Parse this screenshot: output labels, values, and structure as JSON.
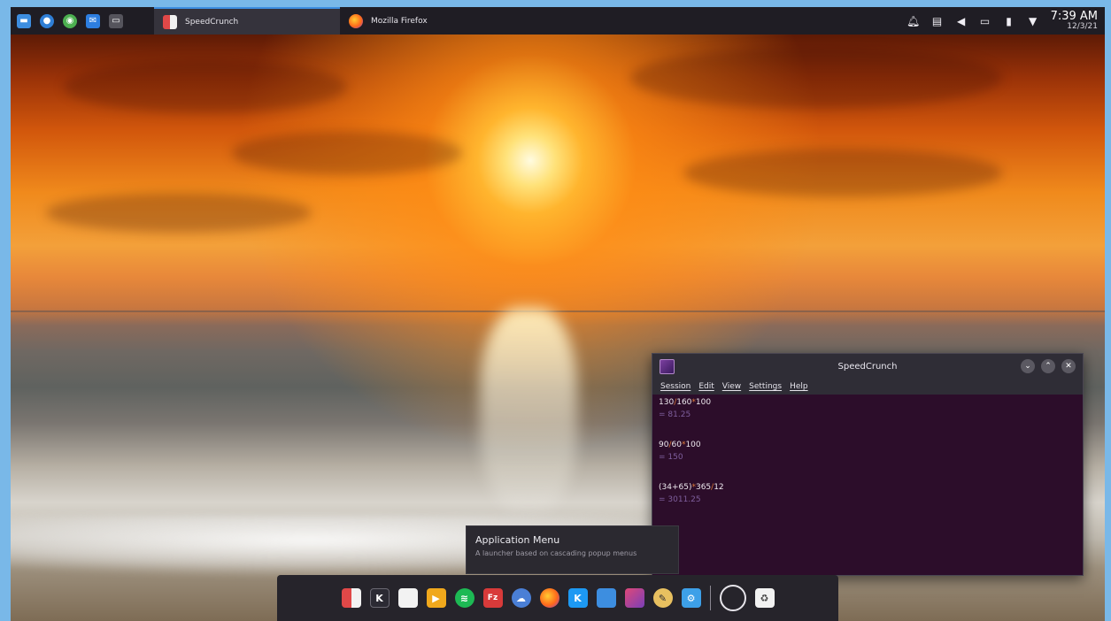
{
  "top_panel": {
    "launchers": [
      {
        "name": "dolphin-icon",
        "color": "#3d8ee0"
      },
      {
        "name": "discover-icon",
        "color": "#2f7fd6"
      },
      {
        "name": "chrome-icon",
        "color": "#4caf50"
      },
      {
        "name": "kmail-icon",
        "color": "#2d7ee0"
      },
      {
        "name": "terminal-icon",
        "color": "#55545c"
      }
    ],
    "tasks": [
      {
        "label": "SpeedCrunch",
        "icon": "speedcrunch-icon",
        "active": true
      },
      {
        "label": "Mozilla Firefox",
        "icon": "firefox-icon",
        "active": false
      }
    ],
    "tray": [
      "bell-icon",
      "clipboard-icon",
      "volume-icon",
      "battery-icon",
      "usb-icon",
      "wifi-icon"
    ],
    "clock": {
      "time": "7:39 AM",
      "date": "12/3/21"
    }
  },
  "speedcrunch": {
    "title": "SpeedCrunch",
    "menu": [
      "Session",
      "Edit",
      "View",
      "Settings",
      "Help"
    ],
    "entries": [
      {
        "expr_parts": [
          "130",
          "/",
          "160",
          "*",
          "100"
        ],
        "result": "= 81.25"
      },
      {
        "expr_parts": [
          "90",
          "/",
          "60",
          "*",
          "100"
        ],
        "result": "= 150"
      },
      {
        "expr_parts": [
          "(34+65)",
          "*",
          "365",
          "/",
          "12"
        ],
        "result": "= 3011.25"
      }
    ]
  },
  "tooltip": {
    "title": "Application Menu",
    "subtitle": "A launcher based on cascading popup menus"
  },
  "dock": {
    "icons": [
      {
        "name": "speedcrunch-icon",
        "color": "#e04848",
        "glyph": "▮"
      },
      {
        "name": "kdevelop-icon",
        "color": "#2b2a33",
        "glyph": "K"
      },
      {
        "name": "document-icon",
        "color": "#f2f2f2",
        "glyph": ""
      },
      {
        "name": "slides-icon",
        "color": "#f0a81c",
        "glyph": "▶"
      },
      {
        "name": "spotify-icon",
        "color": "#1db954",
        "glyph": "≋"
      },
      {
        "name": "filezilla-icon",
        "color": "#d83a3a",
        "glyph": "Fz"
      },
      {
        "name": "cloud-icon",
        "color": "#4a7fd6",
        "glyph": "☁"
      },
      {
        "name": "firefox-icon",
        "color": "#ff6a1a",
        "glyph": "●"
      },
      {
        "name": "kde-store-icon",
        "color": "#1d99f3",
        "glyph": "K"
      },
      {
        "name": "folder-icon",
        "color": "#3d8ee0",
        "glyph": ""
      },
      {
        "name": "screen-icon",
        "color": "#7a3fb8",
        "glyph": ""
      },
      {
        "name": "kgpg-icon",
        "color": "#e8c060",
        "glyph": "✎"
      },
      {
        "name": "system-monitor-icon",
        "color": "#3da0e8",
        "glyph": "⚙"
      }
    ],
    "trash_glyph": "♻"
  }
}
